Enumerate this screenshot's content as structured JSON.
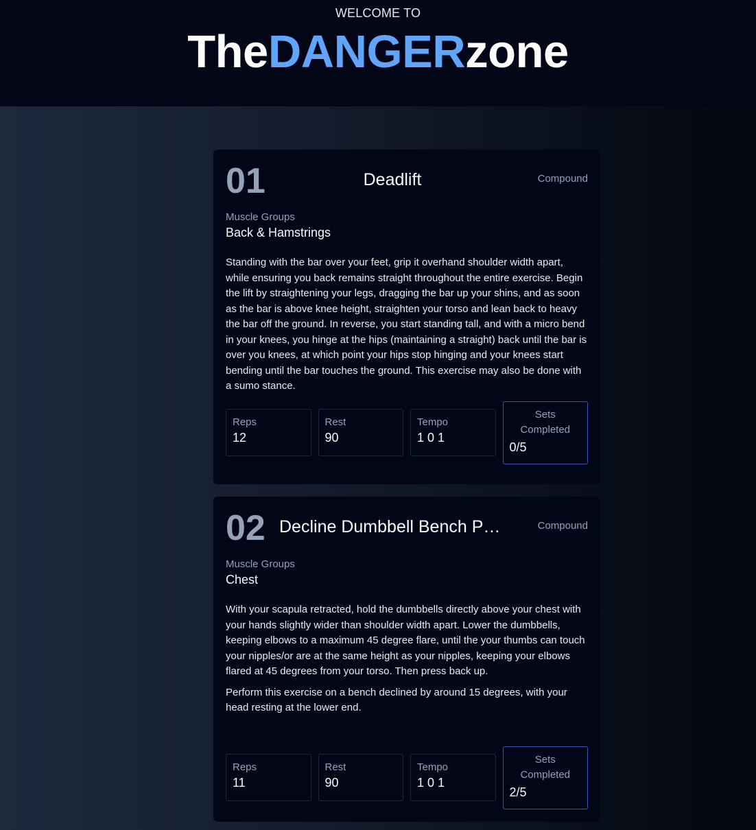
{
  "header": {
    "welcome": "WELCOME TO",
    "brand_the": "The",
    "brand_danger": "DANGER",
    "brand_zone": "zone"
  },
  "exercises": [
    {
      "number": "01",
      "name": "Deadlift",
      "type": "Compound",
      "muscle_groups_label": "Muscle Groups",
      "muscle_groups": "Back & Hamstrings",
      "description": [
        "Standing with the bar over your feet, grip it overhand shoulder width apart, while ensuring you back remains straight throughout the entire exercise. Begin the lift by straightening your legs, dragging the bar up your shins, and as soon as the bar is above knee height, straighten your torso and lean back to heavy the bar off the ground. In reverse, you start standing tall, and with a micro bend in your knees, you hinge at the hips (maintaining a straight) back until the bar is over you knees, at which point your hips stop hinging and your knees start bending until the bar touches the ground. This exercise may also be done with a sumo stance."
      ],
      "reps_label": "Reps",
      "reps": "12",
      "rest_label": "Rest",
      "rest": "90",
      "tempo_label": "Tempo",
      "tempo": "1 0 1",
      "sets_label": "Sets Completed",
      "sets": "0/5"
    },
    {
      "number": "02",
      "name": "Decline Dumbbell Bench P…",
      "type": "Compound",
      "muscle_groups_label": "Muscle Groups",
      "muscle_groups": "Chest",
      "description": [
        "With your scapula retracted, hold the dumbbells directly above your chest with your hands slightly wider than shoulder width apart. Lower the dumbbells, keeping elbows to a maximum 45 degree flare, until the your thumbs can touch your nipples/or are at the same height as your nipples, keeping your elbows flared at 45 degrees from your torso. Then press back up.",
        "Perform this exercise on a bench declined by around 15 degrees, with your head resting at the lower end."
      ],
      "reps_label": "Reps",
      "reps": "11",
      "rest_label": "Rest",
      "rest": "90",
      "tempo_label": "Tempo",
      "tempo": "1 0 1",
      "sets_label": "Sets Completed",
      "sets": "2/5"
    }
  ]
}
